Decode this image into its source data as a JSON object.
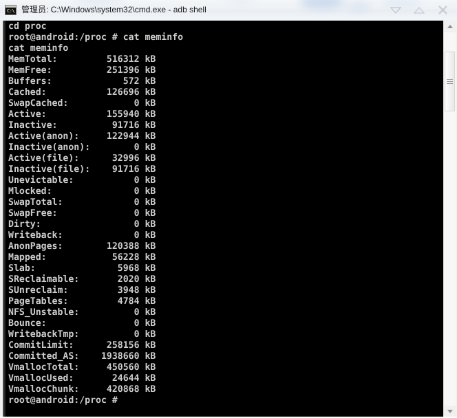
{
  "window": {
    "title": "管理员: C:\\Windows\\system32\\cmd.exe - adb  shell",
    "icon_name": "cmd-prompt-icon",
    "icon_glyph": "C:\\",
    "controls": {
      "minimize_label": "▽",
      "maximize_label": "△",
      "close_label": "✕"
    }
  },
  "terminal": {
    "colors": {
      "background": "#000000",
      "foreground": "#cccccc"
    },
    "lines": [
      "cd proc",
      "root@android:/proc # cat meminfo",
      "cat meminfo",
      "MemTotal:         516312 kB",
      "MemFree:          251396 kB",
      "Buffers:             572 kB",
      "Cached:           126696 kB",
      "SwapCached:            0 kB",
      "Active:           155940 kB",
      "Inactive:          91716 kB",
      "Active(anon):     122944 kB",
      "Inactive(anon):        0 kB",
      "Active(file):      32996 kB",
      "Inactive(file):    91716 kB",
      "Unevictable:           0 kB",
      "Mlocked:               0 kB",
      "SwapTotal:             0 kB",
      "SwapFree:              0 kB",
      "Dirty:                 0 kB",
      "Writeback:             0 kB",
      "AnonPages:        120388 kB",
      "Mapped:            56228 kB",
      "Slab:               5968 kB",
      "SReclaimable:       2020 kB",
      "SUnreclaim:         3948 kB",
      "PageTables:         4784 kB",
      "NFS_Unstable:          0 kB",
      "Bounce:                0 kB",
      "WritebackTmp:          0 kB",
      "CommitLimit:      258156 kB",
      "Committed_AS:    1938660 kB",
      "VmallocTotal:     450560 kB",
      "VmallocUsed:       24644 kB",
      "VmallocChunk:     420868 kB",
      "root@android:/proc #"
    ],
    "command_entered": "cat meminfo",
    "prompt": "root@android:/proc #",
    "meminfo": {
      "unit": "kB",
      "entries": [
        {
          "key": "MemTotal",
          "value": 516312
        },
        {
          "key": "MemFree",
          "value": 251396
        },
        {
          "key": "Buffers",
          "value": 572
        },
        {
          "key": "Cached",
          "value": 126696
        },
        {
          "key": "SwapCached",
          "value": 0
        },
        {
          "key": "Active",
          "value": 155940
        },
        {
          "key": "Inactive",
          "value": 91716
        },
        {
          "key": "Active(anon)",
          "value": 122944
        },
        {
          "key": "Inactive(anon)",
          "value": 0
        },
        {
          "key": "Active(file)",
          "value": 32996
        },
        {
          "key": "Inactive(file)",
          "value": 91716
        },
        {
          "key": "Unevictable",
          "value": 0
        },
        {
          "key": "Mlocked",
          "value": 0
        },
        {
          "key": "SwapTotal",
          "value": 0
        },
        {
          "key": "SwapFree",
          "value": 0
        },
        {
          "key": "Dirty",
          "value": 0
        },
        {
          "key": "Writeback",
          "value": 0
        },
        {
          "key": "AnonPages",
          "value": 120388
        },
        {
          "key": "Mapped",
          "value": 56228
        },
        {
          "key": "Slab",
          "value": 5968
        },
        {
          "key": "SReclaimable",
          "value": 2020
        },
        {
          "key": "SUnreclaim",
          "value": 3948
        },
        {
          "key": "PageTables",
          "value": 4784
        },
        {
          "key": "NFS_Unstable",
          "value": 0
        },
        {
          "key": "Bounce",
          "value": 0
        },
        {
          "key": "WritebackTmp",
          "value": 0
        },
        {
          "key": "CommitLimit",
          "value": 258156
        },
        {
          "key": "Committed_AS",
          "value": 1938660
        },
        {
          "key": "VmallocTotal",
          "value": 450560
        },
        {
          "key": "VmallocUsed",
          "value": 24644
        },
        {
          "key": "VmallocChunk",
          "value": 420868
        }
      ]
    }
  },
  "scrollbar": {
    "up_arrow": "▲",
    "down_arrow": "▼",
    "orientation": "vertical"
  }
}
